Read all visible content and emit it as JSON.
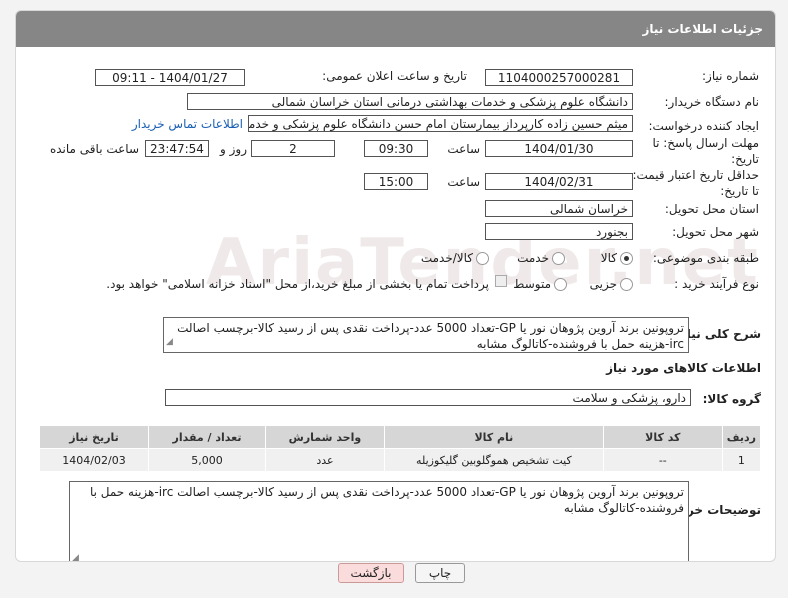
{
  "header": {
    "title": "جزئیات اطلاعات نیاز"
  },
  "watermark": "AriaTender.net",
  "form": {
    "need_number_label": "شماره نیاز:",
    "need_number": "1104000257000281",
    "announce_label": "تاریخ و ساعت اعلان عمومی:",
    "announce_value": "1404/01/27 - 09:11",
    "buyer_org_label": "نام دستگاه خریدار:",
    "buyer_org": "دانشگاه علوم پزشکی و خدمات بهداشتی درمانی استان خراسان شمالی",
    "requester_label": "ایجاد کننده درخواست:",
    "requester": "میثم  حسین زاده  کارپرداز بیمارستان امام حسن دانشگاه علوم پزشکی و خدمات",
    "contact_link": "اطلاعات تماس خریدار",
    "reply_deadline_label_1": "مهلت ارسال پاسخ: تا",
    "reply_deadline_label_2": "تاریخ:",
    "reply_date": "1404/01/30",
    "time_label": "ساعت",
    "reply_time": "09:30",
    "days_value": "2",
    "days_label": "روز و",
    "remaining_value": "23:47:54",
    "remaining_label": "ساعت باقی مانده",
    "price_deadline_label_1": "حداقل تاریخ اعتبار قیمت:",
    "price_deadline_label_2": "تا تاریخ:",
    "price_date": "1404/02/31",
    "price_time": "15:00",
    "province_label": "استان محل تحویل:",
    "province": "خراسان شمالی",
    "city_label": "شهر محل تحویل:",
    "city": "بجنورد",
    "category_label": "طبقه بندی موضوعی:",
    "category_options": [
      "کالا",
      "خدمت",
      "کالا/خدمت"
    ],
    "process_label": "نوع فرآیند خرید :",
    "process_options": [
      "جزیی",
      "متوسط"
    ],
    "payment_note": "پرداخت تمام یا بخشی از مبلغ خرید،از محل \"اسناد خزانه اسلامی\" خواهد بود."
  },
  "description": {
    "label": "شرح کلی نیاز:",
    "text": "تروپونین برند آروین پژوهان نور یا GP-تعداد 5000 عدد-پرداخت نقدی پس از رسید کالا-برچسب اصالت irc-هزینه حمل با فروشنده-کاتالوگ مشابه"
  },
  "goods_section": {
    "title": "اطلاعات کالاهای مورد نیاز",
    "group_label": "گروه کالا:",
    "group_value": "دارو، پزشکی و سلامت"
  },
  "table": {
    "headers": [
      "ردیف",
      "کد کالا",
      "نام کالا",
      "واحد شمارش",
      "تعداد / مقدار",
      "تاریخ نیاز"
    ],
    "rows": [
      {
        "row": "1",
        "code": "--",
        "name": "کیت تشخیص هموگلوبین گلیکوزیله",
        "unit": "عدد",
        "qty": "5,000",
        "date": "1404/02/03"
      }
    ]
  },
  "buyer_notes": {
    "label": "توضیحات خریدار:",
    "text": "تروپونین برند آروین پژوهان نور یا GP-تعداد 5000 عدد-پرداخت نقدی پس از رسید کالا-برچسب اصالت irc-هزینه حمل با فروشنده-کاتالوگ مشابه"
  },
  "buttons": {
    "print": "چاپ",
    "back": "بازگشت"
  }
}
